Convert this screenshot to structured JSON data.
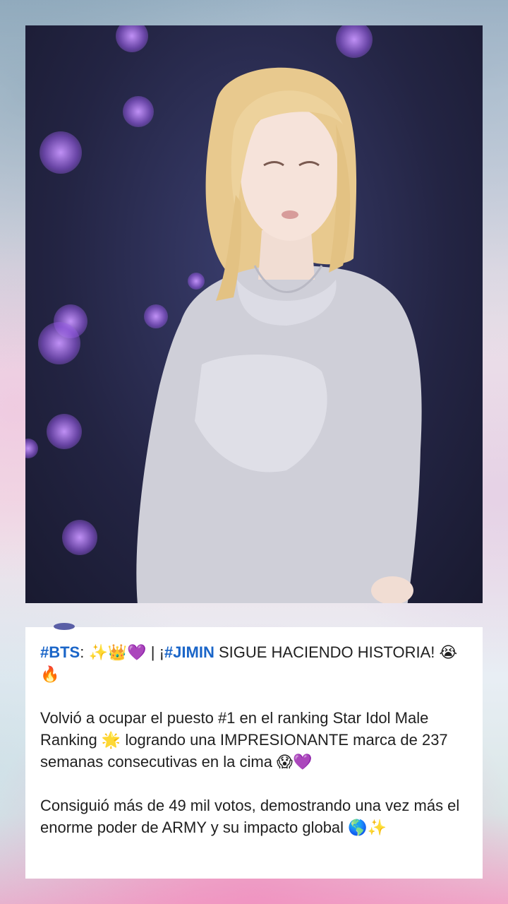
{
  "post": {
    "headline": {
      "tag1": "#BTS",
      "sep1": ": ✨👑💜 | ¡",
      "tag2": "#JIMIN",
      "rest": " SIGUE HACIENDO HISTORIA! 😭🔥"
    },
    "paragraph1": "Volvió a ocupar el puesto #1 en el ranking Star Idol Male Ranking 🌟 logrando una IMPRESIONANTE marca de 237 semanas consecutivas en la cima 😱💜",
    "paragraph2": "Consiguió más de 49 mil votos, demostrando una vez más el enorme poder de ARMY y su impacto global 🌎✨"
  },
  "colors": {
    "hashtag": "#1a65c8",
    "card_background": "#ffffff",
    "bokeh": "#b07ff0"
  },
  "photo": {
    "subject": "performer-with-long-blonde-hair-in-grey-hoodie"
  }
}
